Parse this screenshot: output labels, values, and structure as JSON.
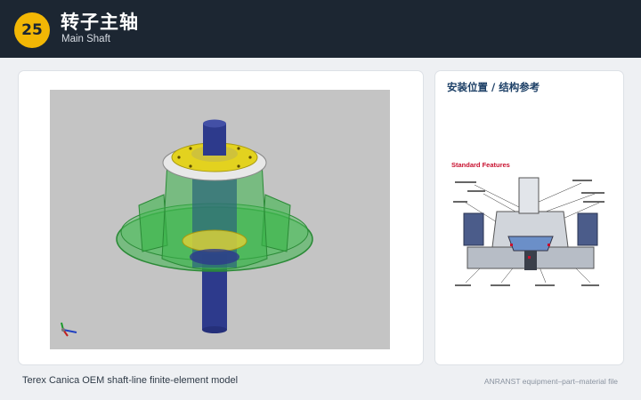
{
  "header": {
    "number": "25",
    "title_zh": "转子主轴",
    "title_en": "Main Shaft"
  },
  "sidebar_card": {
    "heading": "安装位置 / 结构参考",
    "reference_title": "Standard Features"
  },
  "footer": {
    "caption": "Terex Canica OEM shaft-line finite-element model",
    "source": "ANRANST equipment–part–material file"
  },
  "colors": {
    "header_bg": "#1c2632",
    "badge": "#f2b705",
    "model_housing": "#3ab54a",
    "shaft": "#2d3a8c",
    "flange": "#e3d21f",
    "heading_accent": "#1c3f66"
  }
}
